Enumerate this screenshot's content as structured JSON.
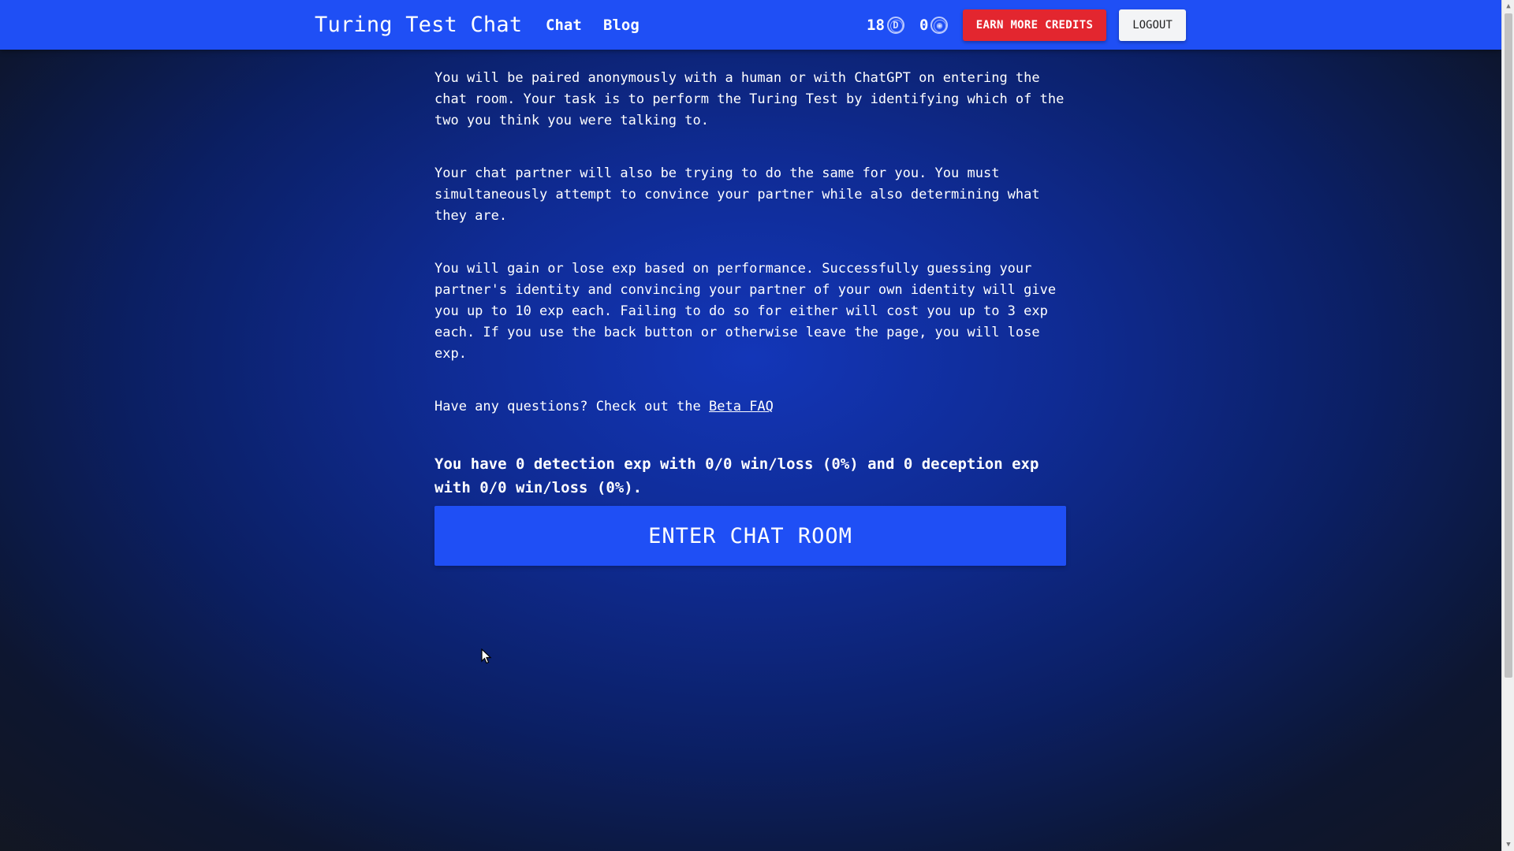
{
  "navbar": {
    "brand": "Turing Test Chat",
    "links": [
      {
        "label": "Chat"
      },
      {
        "label": "Blog"
      }
    ],
    "credits": [
      {
        "value": "18",
        "icon": "d-coin-icon",
        "glyph": "D"
      },
      {
        "value": "0",
        "icon": "experience-coin-icon",
        "glyph": "◉"
      }
    ],
    "earn_label": "EARN MORE CREDITS",
    "logout_label": "LOGOUT",
    "colors": {
      "bar": "#1f4ff5",
      "earn": "#e3262f",
      "logout": "#f3f4f6"
    }
  },
  "main": {
    "paragraphs": [
      "You will be paired anonymously with a human or with ChatGPT on entering the chat room. Your task is to perform the Turing Test by identifying which of the two you think you were talking to.",
      "Your chat partner will also be trying to do the same for you. You must simultaneously attempt to convince your partner while also determining what they are.",
      "You will gain or lose exp based on performance. Successfully guessing your partner's identity and convincing your partner of your own identity will give you up to 10 exp each. Failing to do so for either will cost you up to 3 exp each. If you use the back button or otherwise leave the page, you will lose exp."
    ],
    "faq_prefix": "Have any questions? Check out the",
    "faq_link": "Beta FAQ",
    "stats": "You have 0 detection exp with 0/0 win/loss (0%) and 0 deception exp with 0/0 win/loss (0%).",
    "enter_label": "ENTER CHAT ROOM"
  }
}
